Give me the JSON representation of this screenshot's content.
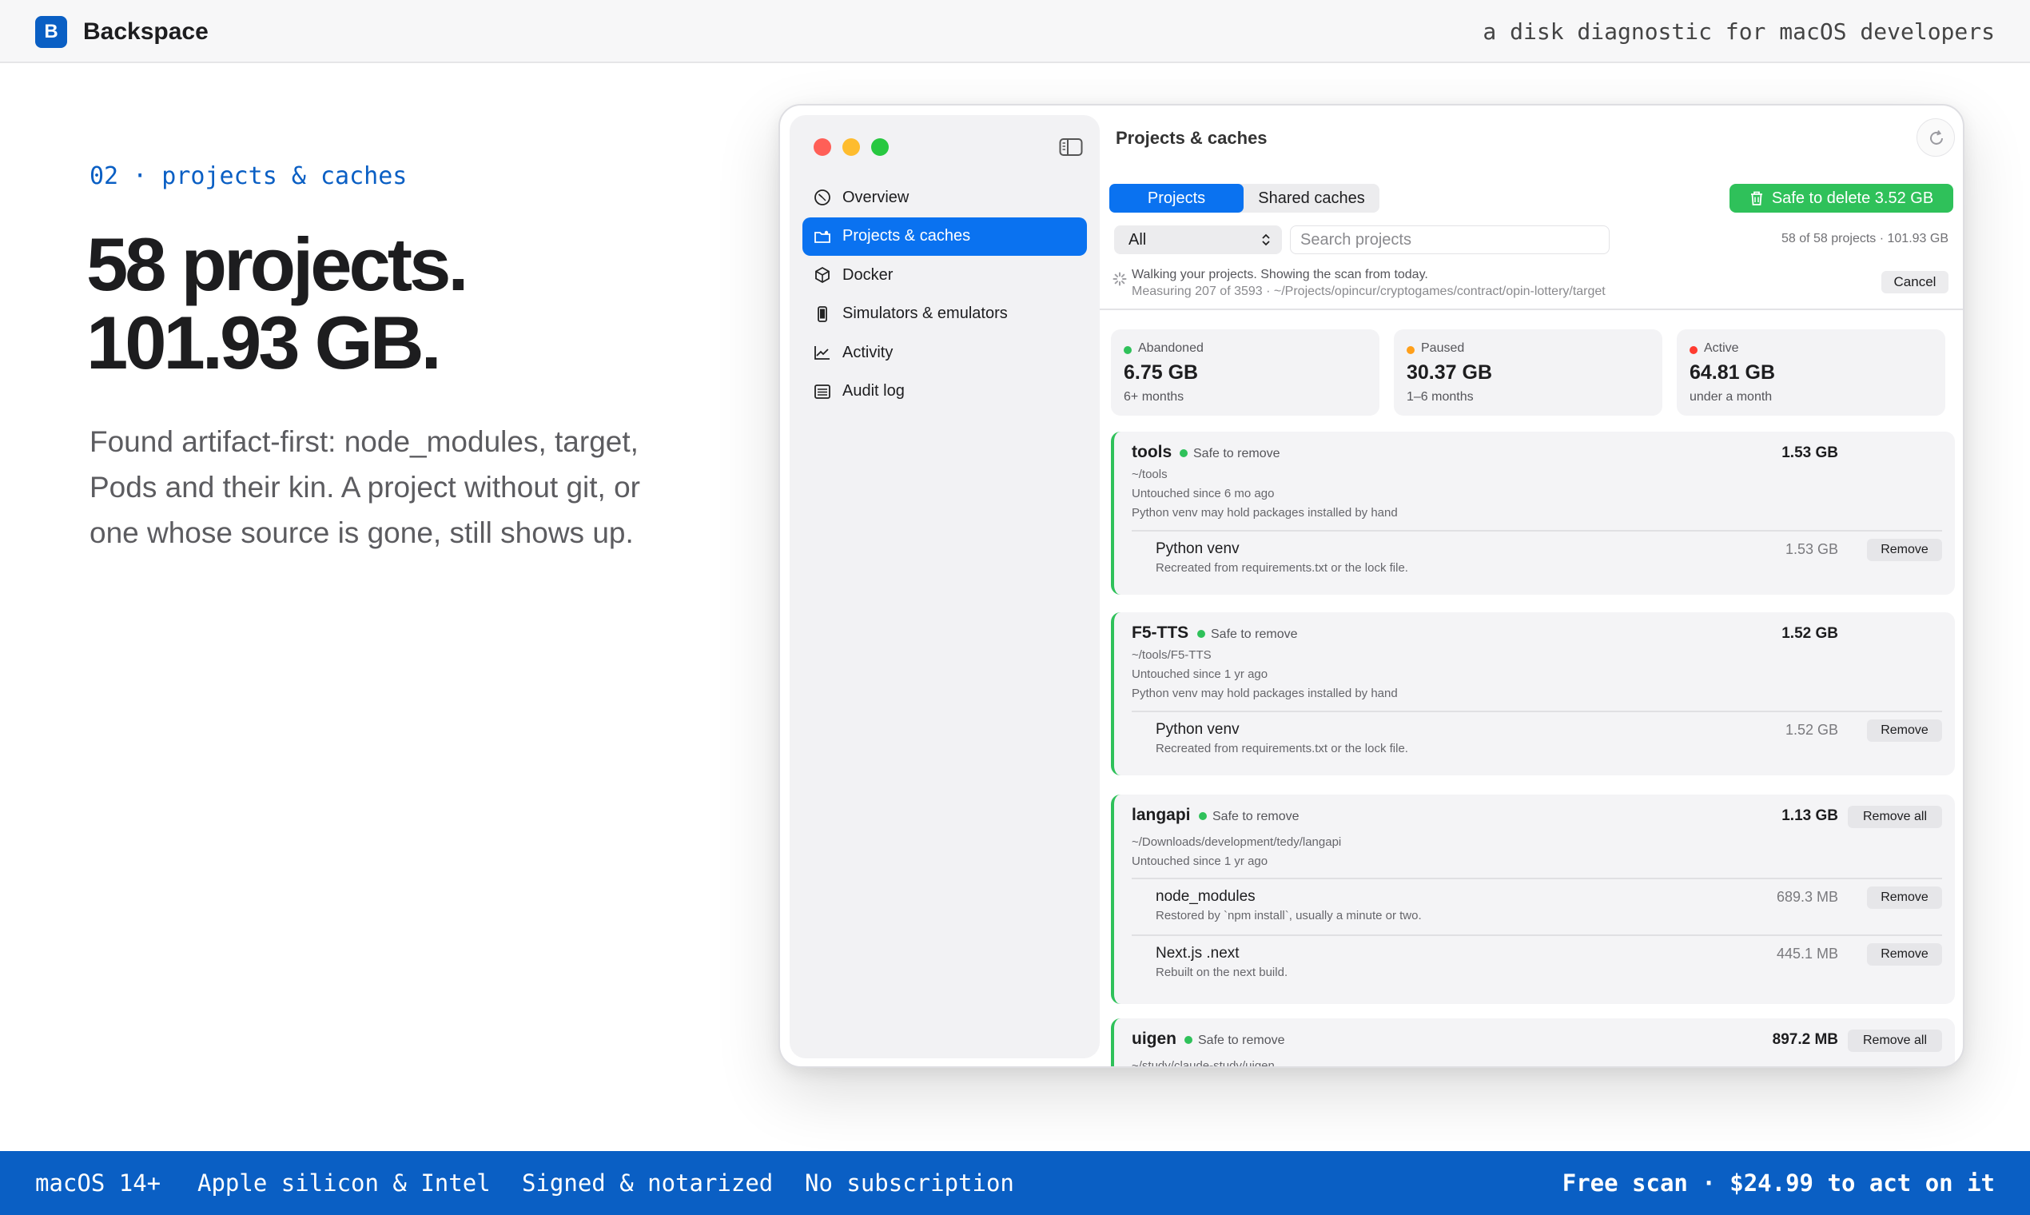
{
  "site": {
    "logo_letter": "B",
    "brand": "Backspace",
    "tagline": "a disk diagnostic for macOS developers"
  },
  "hero": {
    "eyebrow": "02 · projects & caches",
    "headline_line1": "58 projects.",
    "headline_line2": "101.93 GB.",
    "description": "Found artifact-first: node_modules, target, Pods and their kin. A project without git, or one whose source is gone, still shows up."
  },
  "footer": {
    "items": [
      "macOS 14+",
      "Apple silicon & Intel",
      "Signed & notarized",
      "No subscription"
    ],
    "cta": "Free scan · $24.99 to act on it"
  },
  "app": {
    "sidebar": {
      "items": [
        {
          "label": "Overview",
          "icon": "gauge-icon"
        },
        {
          "label": "Projects & caches",
          "icon": "folder-icon",
          "active": true
        },
        {
          "label": "Docker",
          "icon": "cube-icon"
        },
        {
          "label": "Simulators & emulators",
          "icon": "phone-icon"
        },
        {
          "label": "Activity",
          "icon": "chart-line-icon"
        },
        {
          "label": "Audit log",
          "icon": "list-icon"
        }
      ]
    },
    "main": {
      "title": "Projects & caches",
      "tabs": [
        "Projects",
        "Shared caches"
      ],
      "safe_delete": "Safe to delete 3.52 GB",
      "filter_value": "All",
      "search_placeholder": "Search projects",
      "count": "58 of 58 projects · 101.93 GB",
      "scan_status": "Walking your projects. Showing the scan from today.",
      "scan_detail": "Measuring 207 of 3593 · ~/Projects/opincur/cryptogames/contract/opin-lottery/target",
      "cancel": "Cancel",
      "stats": [
        {
          "label": "Abandoned",
          "value": "6.75 GB",
          "sub": "6+ months",
          "color": "#2fc15a"
        },
        {
          "label": "Paused",
          "value": "30.37 GB",
          "sub": "1–6 months",
          "color": "#ff9f1a"
        },
        {
          "label": "Active",
          "value": "64.81 GB",
          "sub": "under a month",
          "color": "#ff3b30"
        }
      ],
      "projects": [
        {
          "name": "tools",
          "badge": "Safe to remove",
          "size": "1.53 GB",
          "path": "~/tools",
          "untouched": "Untouched since 6 mo ago",
          "note": "Python venv may hold packages installed by hand",
          "artifacts": [
            {
              "name": "Python venv",
              "desc": "Recreated from requirements.txt or the lock file.",
              "size": "1.53 GB",
              "action": "Remove"
            }
          ]
        },
        {
          "name": "F5-TTS",
          "badge": "Safe to remove",
          "size": "1.52 GB",
          "path": "~/tools/F5-TTS",
          "untouched": "Untouched since 1 yr ago",
          "note": "Python venv may hold packages installed by hand",
          "artifacts": [
            {
              "name": "Python venv",
              "desc": "Recreated from requirements.txt or the lock file.",
              "size": "1.52 GB",
              "action": "Remove"
            }
          ]
        },
        {
          "name": "langapi",
          "badge": "Safe to remove",
          "size": "1.13 GB",
          "action_all": "Remove all",
          "path": "~/Downloads/development/tedy/langapi",
          "untouched": "Untouched since 1 yr ago",
          "artifacts": [
            {
              "name": "node_modules",
              "desc": "Restored by `npm install`, usually a minute or two.",
              "size": "689.3 MB",
              "action": "Remove"
            },
            {
              "name": "Next.js .next",
              "desc": "Rebuilt on the next build.",
              "size": "445.1 MB",
              "action": "Remove"
            }
          ]
        },
        {
          "name": "uigen",
          "badge": "Safe to remove",
          "size": "897.2 MB",
          "action_all": "Remove all",
          "path": "~/study/claude-study/uigen"
        }
      ]
    }
  }
}
